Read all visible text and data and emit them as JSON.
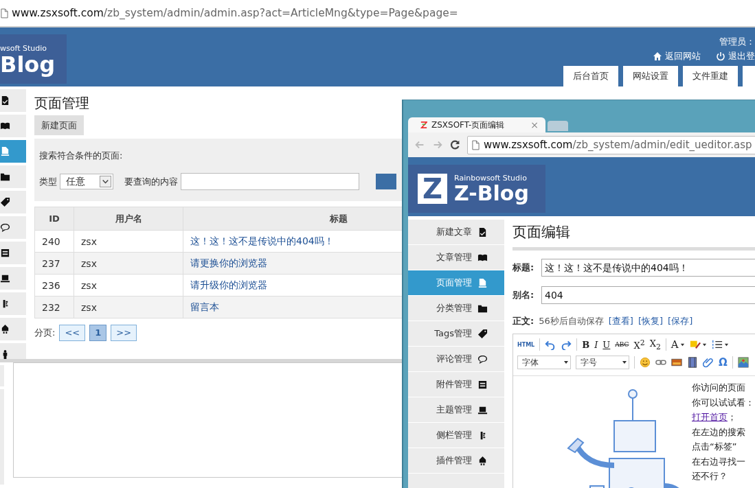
{
  "address_bar": {
    "host": "www.zsxsoft.com",
    "path": "/zb_system/admin/admin.asp?act=ArticleMng&type=Page&page="
  },
  "header": {
    "logo_subtitle": "wsoft Studio",
    "logo_title": "Blog",
    "user_label": "管理员：",
    "links": [
      "返回网站",
      "退出登"
    ],
    "tabs": [
      "后台首页",
      "网站设置",
      "文件重建"
    ]
  },
  "sidebar": [
    {
      "selected": false
    },
    {
      "selected": false
    },
    {
      "selected": true
    },
    {
      "selected": false
    },
    {
      "selected": false
    },
    {
      "selected": false
    },
    {
      "selected": false
    },
    {
      "selected": false
    },
    {
      "selected": false
    },
    {
      "selected": false
    },
    {
      "selected": false
    }
  ],
  "main": {
    "title": "页面管理",
    "new_button": "新建页面",
    "search": {
      "heading": "搜索符合条件的页面:",
      "type_label": "类型",
      "type_value": "任意",
      "query_label": "要查询的内容"
    },
    "table": {
      "columns": [
        "ID",
        "用户名",
        "标题"
      ],
      "rows": [
        {
          "id": "240",
          "user": "zsx",
          "title": "这！这！这不是传说中的404吗！"
        },
        {
          "id": "237",
          "user": "zsx",
          "title": "请更换你的浏览器"
        },
        {
          "id": "236",
          "user": "zsx",
          "title": "请升级你的浏览器"
        },
        {
          "id": "232",
          "user": "zsx",
          "title": "留言本"
        }
      ]
    },
    "pagination": {
      "label": "分页:",
      "pages": [
        {
          "label": "<<",
          "selected": false
        },
        {
          "label": "1",
          "selected": true
        },
        {
          "label": ">>",
          "selected": false
        }
      ]
    }
  },
  "editor_window": {
    "tab_title": "ZSXSOFT-页面编辑",
    "close": "×",
    "url_host": "www.zsxsoft.com",
    "url_path": "/zb_system/admin/edit_ueditor.asp",
    "logo_mark": "Z",
    "logo_subtitle": "Rainbowsoft Studio",
    "logo_title": "Z-Blog",
    "sidebar": [
      {
        "label": "新建文章",
        "selected": false
      },
      {
        "label": "文章管理",
        "selected": false
      },
      {
        "label": "页面管理",
        "selected": true
      },
      {
        "label": "分类管理",
        "selected": false
      },
      {
        "label": "Tags管理",
        "selected": false
      },
      {
        "label": "评论管理",
        "selected": false
      },
      {
        "label": "附件管理",
        "selected": false
      },
      {
        "label": "主题管理",
        "selected": false
      },
      {
        "label": "侧栏管理",
        "selected": false
      },
      {
        "label": "插件管理",
        "selected": false
      }
    ],
    "title": "页面编辑",
    "fields": [
      {
        "label": "标题:",
        "value": "这！这！这不是传说中的404吗！"
      },
      {
        "label": "别名:",
        "value": "404"
      }
    ],
    "body_label": "正文:",
    "autosave": "56秒后自动保存",
    "actions": [
      "[查看]",
      "[恢复]",
      "[保存]"
    ],
    "toolbar": {
      "html": "HTML",
      "format": [
        "B",
        "I",
        "U",
        "ABC",
        "X$^{2}$",
        "X$_{2}$"
      ],
      "font_color": "A",
      "font_family": "字体",
      "font_size": "字号",
      "special_char": "Ω"
    },
    "content_lines": [
      {
        "text": "你访问的页面"
      },
      {
        "text": "你可以试试看："
      },
      {
        "link": "打开首页",
        "text": "；"
      },
      {
        "text": "在左边的搜索"
      },
      {
        "text": "点击“标签”"
      },
      {
        "text": "在右边寻找一"
      },
      {
        "text": "还不行？"
      }
    ]
  }
}
